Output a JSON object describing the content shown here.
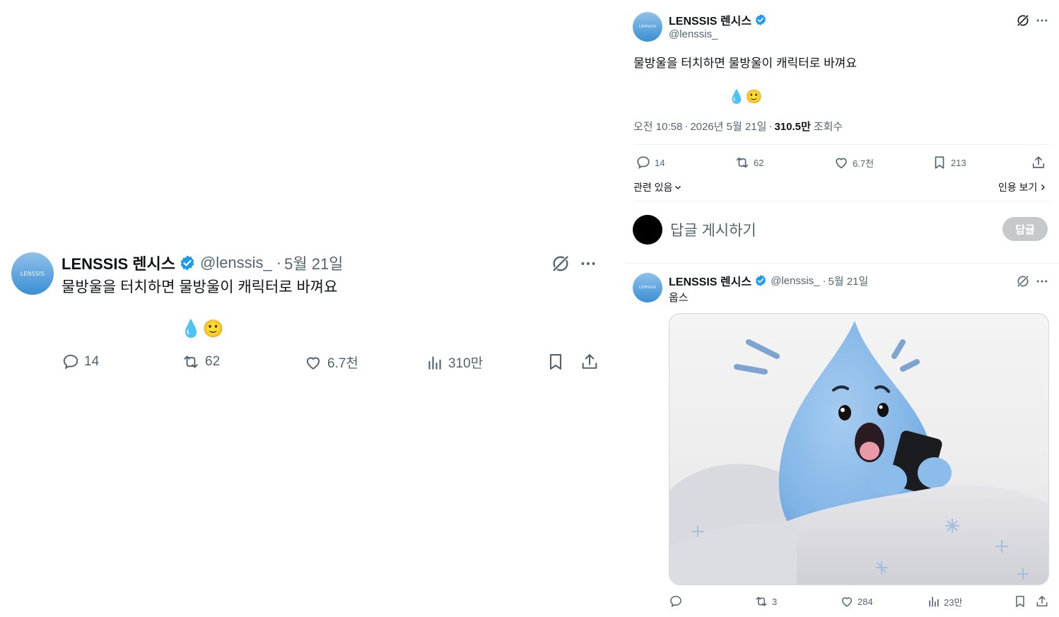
{
  "left_tweet": {
    "avatar_text": "LENSSIS",
    "display_name": "LENSSIS 렌시스",
    "handle": "@lenssis_",
    "separator": "·",
    "date": "5월 21일",
    "text": "물방울을 터치하면 물방울이 캐릭터로 바껴요",
    "emoji_drop": "💧",
    "emoji_smile": "🙂",
    "replies": "14",
    "retweets": "62",
    "likes": "6.7천",
    "views": "310만"
  },
  "right_tweet": {
    "avatar_text": "LENSSIS",
    "display_name": "LENSSIS 렌시스",
    "handle": "@lenssis_",
    "text": "물방울을 터치하면 물방울이 캐릭터로 바껴요",
    "emoji_drop": "💧",
    "emoji_smile": "🙂",
    "time": "오전 10:58",
    "date": "2026년 5월 21일",
    "views_count": "310.5만",
    "views_label": "조회수",
    "replies": "14",
    "retweets": "62",
    "likes": "6.7천",
    "bookmarks": "213",
    "related_label": "관련 있음",
    "quotes_label": "인용 보기"
  },
  "reply_composer": {
    "placeholder": "답글 게시하기",
    "button_label": "답글"
  },
  "reply_tweet": {
    "avatar_text": "LENSSIS",
    "display_name": "LENSSIS 렌시스",
    "handle": "@lenssis_",
    "separator": "·",
    "date": "5월 21일",
    "text": "웁스",
    "replies": "",
    "retweets": "3",
    "likes": "284",
    "views": "23만"
  },
  "colors": {
    "verified_blue": "#1d9bf0",
    "text_primary": "#0f1419",
    "text_secondary": "#536471",
    "character_blue": "#7fb3e6"
  }
}
